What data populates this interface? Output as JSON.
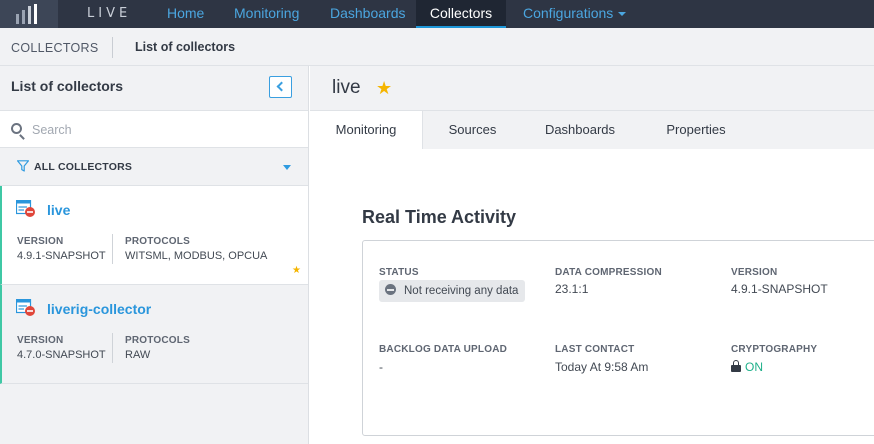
{
  "nav": {
    "brand": "LIVE",
    "items": [
      {
        "label": "Home"
      },
      {
        "label": "Monitoring"
      },
      {
        "label": "Dashboards"
      },
      {
        "label": "Collectors"
      },
      {
        "label": "Configurations"
      }
    ],
    "active": "Collectors"
  },
  "breadcrumb": {
    "section": "COLLECTORS",
    "page": "List of collectors"
  },
  "sidebar": {
    "title": "List of collectors",
    "search": {
      "placeholder": "Search",
      "value": ""
    },
    "filter": {
      "label": "ALL COLLECTORS"
    },
    "collectors": [
      {
        "name": "live",
        "version_label": "VERSION",
        "version": "4.9.1-SNAPSHOT",
        "protocols_label": "PROTOCOLS",
        "protocols": "WITSML, MODBUS, OPCUA",
        "favorite": true,
        "selected": true
      },
      {
        "name": "liverig-collector",
        "version_label": "VERSION",
        "version": "4.7.0-SNAPSHOT",
        "protocols_label": "PROTOCOLS",
        "protocols": "RAW",
        "favorite": false,
        "selected": false
      }
    ]
  },
  "main": {
    "title": "live",
    "favorite": true,
    "tabs": [
      {
        "label": "Monitoring"
      },
      {
        "label": "Sources"
      },
      {
        "label": "Dashboards"
      },
      {
        "label": "Properties"
      }
    ],
    "active_tab": "Monitoring",
    "section_title": "Real Time Activity",
    "activity": {
      "status_label": "STATUS",
      "status": "Not receiving any data",
      "compression_label": "DATA COMPRESSION",
      "compression": "23.1:1",
      "version_label": "VERSION",
      "version": "4.9.1-SNAPSHOT",
      "backlog_label": "BACKLOG DATA UPLOAD",
      "backlog": "-",
      "last_contact_label": "LAST CONTACT",
      "last_contact": "Today At 9:58 Am",
      "cryptography_label": "CRYPTOGRAPHY",
      "cryptography": "ON"
    }
  },
  "colors": {
    "nav_bg": "#2e3544",
    "accent": "#2a96dc",
    "card_border": "#3fc8a5",
    "favorite": "#f5b500",
    "status_off": "#6b7380",
    "crypto_on": "#1fb08a",
    "collector_icon_red": "#e0463a"
  },
  "icons": [
    "logo-bars-icon",
    "search-icon",
    "filter-icon",
    "collector-status-icon",
    "star-icon",
    "chevron-left-icon",
    "not-receiving-icon",
    "lock-icon"
  ]
}
